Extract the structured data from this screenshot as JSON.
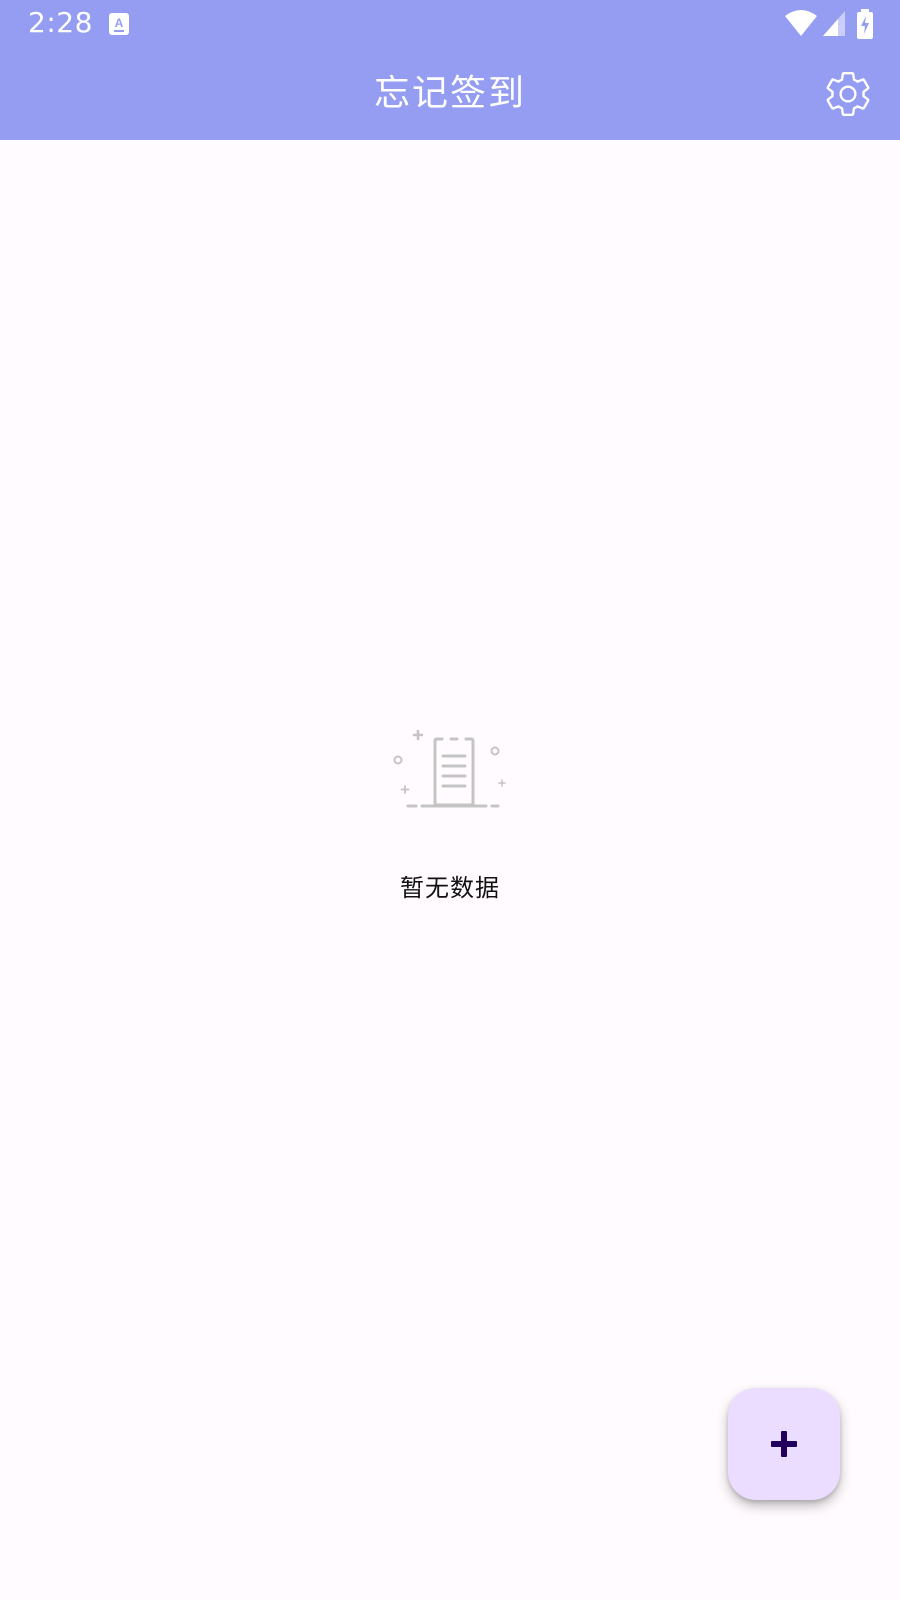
{
  "status_bar": {
    "time": "2:28",
    "notification_icon": "a-keyboard-icon",
    "icons": [
      "wifi-icon",
      "cell-signal-icon",
      "battery-charging-icon"
    ]
  },
  "toolbar": {
    "title": "忘记签到",
    "settings_icon": "gear-icon"
  },
  "empty_state": {
    "illustration_icon": "empty-clipboard-icon",
    "message": "暂无数据"
  },
  "fab": {
    "icon": "plus-icon"
  },
  "colors": {
    "header": "#949df2",
    "background": "#fffbfe",
    "fab_background": "#eaddff",
    "fab_icon": "#21005d",
    "illustration": "#c4c4c4"
  }
}
